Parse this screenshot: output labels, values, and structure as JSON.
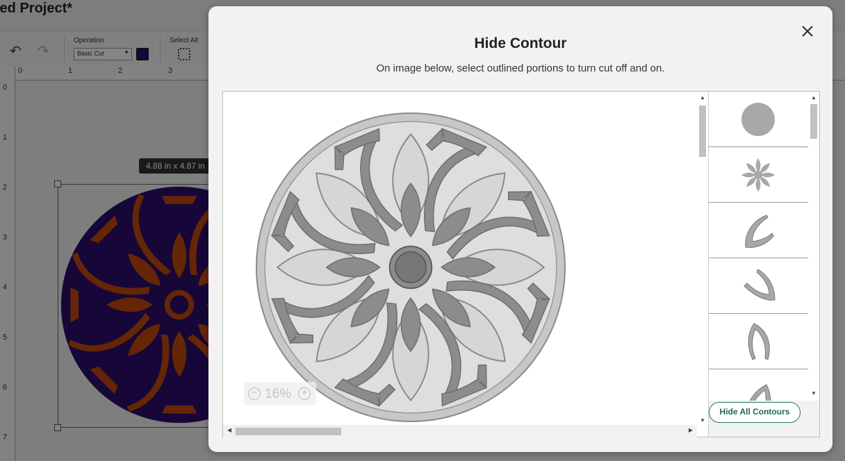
{
  "app": {
    "title": "led Project*",
    "toolbar": {
      "operation_label": "Operation",
      "operation_value": "Basic Cut",
      "select_all_label": "Select All",
      "swatch_color": "#2d0f6e"
    },
    "ruler_top": [
      "0",
      "1",
      "2",
      "3"
    ],
    "ruler_left": [
      "0",
      "1",
      "2",
      "3",
      "4",
      "5",
      "6",
      "7"
    ],
    "size_tooltip": "4.88  in x 4.87  in",
    "mandala_colors": {
      "base": "#2d0f6e",
      "petal": "#c24a0c"
    }
  },
  "modal": {
    "title": "Hide Contour",
    "subtitle": "On image below, select outlined portions to turn cut off and on.",
    "zoom_value": "16%",
    "hide_all_label": "Hide All Contours",
    "accent": "#1c7a53",
    "contour_thumbs": [
      "circle-contour-icon",
      "flower-contour-icon",
      "leaf-contour-icon",
      "leaf-contour-icon",
      "leaf-contour-icon",
      "leaf-contour-icon"
    ]
  }
}
